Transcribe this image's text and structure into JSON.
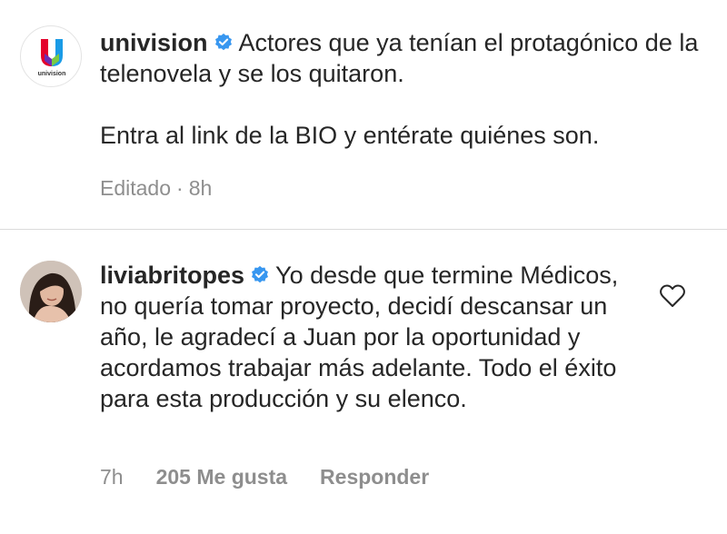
{
  "post": {
    "username": "univision",
    "avatar_icon": "univision-logo-icon",
    "avatar_wordmark": "univision",
    "verified_icon": "verified-badge-icon",
    "caption_line1": "Actores que ya tenían el protagónico de la telenovela y se los quitaron.",
    "caption_line2": "Entra al link de la BIO y entérate quiénes son.",
    "edited_label": "Editado",
    "separator": "·",
    "time": "8h"
  },
  "comment": {
    "username": "liviabritopes",
    "avatar_icon": "profile-photo-avatar",
    "verified_icon": "verified-badge-icon",
    "text": "Yo desde que termine Médicos, no quería tomar proyecto, decidí descansar un año, le agradecí a Juan por la oportunidad y acordamos trabajar más adelante. Todo el éxito para esta producción y su elenco.",
    "time": "7h",
    "likes_label": "205 Me gusta",
    "reply_label": "Responder",
    "like_icon": "heart-outline-icon"
  },
  "colors": {
    "text_primary": "#262626",
    "text_secondary": "#8e8e8e",
    "verified_blue": "#3897f0",
    "divider": "#dbdbdb"
  }
}
